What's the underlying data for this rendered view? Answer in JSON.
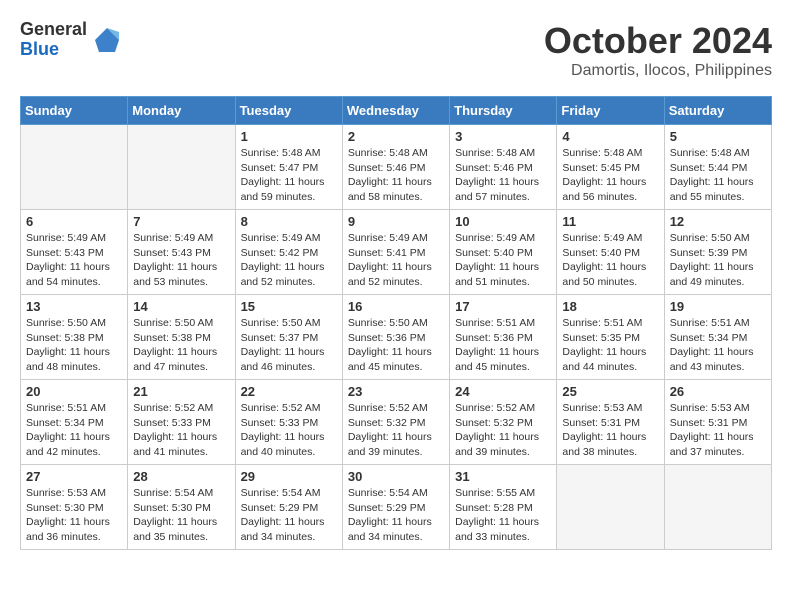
{
  "logo": {
    "general": "General",
    "blue": "Blue"
  },
  "title": "October 2024",
  "location": "Damortis, Ilocos, Philippines",
  "headers": [
    "Sunday",
    "Monday",
    "Tuesday",
    "Wednesday",
    "Thursday",
    "Friday",
    "Saturday"
  ],
  "weeks": [
    [
      {
        "day": "",
        "empty": true
      },
      {
        "day": "",
        "empty": true
      },
      {
        "day": "1",
        "sunrise": "Sunrise: 5:48 AM",
        "sunset": "Sunset: 5:47 PM",
        "daylight": "Daylight: 11 hours and 59 minutes."
      },
      {
        "day": "2",
        "sunrise": "Sunrise: 5:48 AM",
        "sunset": "Sunset: 5:46 PM",
        "daylight": "Daylight: 11 hours and 58 minutes."
      },
      {
        "day": "3",
        "sunrise": "Sunrise: 5:48 AM",
        "sunset": "Sunset: 5:46 PM",
        "daylight": "Daylight: 11 hours and 57 minutes."
      },
      {
        "day": "4",
        "sunrise": "Sunrise: 5:48 AM",
        "sunset": "Sunset: 5:45 PM",
        "daylight": "Daylight: 11 hours and 56 minutes."
      },
      {
        "day": "5",
        "sunrise": "Sunrise: 5:48 AM",
        "sunset": "Sunset: 5:44 PM",
        "daylight": "Daylight: 11 hours and 55 minutes."
      }
    ],
    [
      {
        "day": "6",
        "sunrise": "Sunrise: 5:49 AM",
        "sunset": "Sunset: 5:43 PM",
        "daylight": "Daylight: 11 hours and 54 minutes."
      },
      {
        "day": "7",
        "sunrise": "Sunrise: 5:49 AM",
        "sunset": "Sunset: 5:43 PM",
        "daylight": "Daylight: 11 hours and 53 minutes."
      },
      {
        "day": "8",
        "sunrise": "Sunrise: 5:49 AM",
        "sunset": "Sunset: 5:42 PM",
        "daylight": "Daylight: 11 hours and 52 minutes."
      },
      {
        "day": "9",
        "sunrise": "Sunrise: 5:49 AM",
        "sunset": "Sunset: 5:41 PM",
        "daylight": "Daylight: 11 hours and 52 minutes."
      },
      {
        "day": "10",
        "sunrise": "Sunrise: 5:49 AM",
        "sunset": "Sunset: 5:40 PM",
        "daylight": "Daylight: 11 hours and 51 minutes."
      },
      {
        "day": "11",
        "sunrise": "Sunrise: 5:49 AM",
        "sunset": "Sunset: 5:40 PM",
        "daylight": "Daylight: 11 hours and 50 minutes."
      },
      {
        "day": "12",
        "sunrise": "Sunrise: 5:50 AM",
        "sunset": "Sunset: 5:39 PM",
        "daylight": "Daylight: 11 hours and 49 minutes."
      }
    ],
    [
      {
        "day": "13",
        "sunrise": "Sunrise: 5:50 AM",
        "sunset": "Sunset: 5:38 PM",
        "daylight": "Daylight: 11 hours and 48 minutes."
      },
      {
        "day": "14",
        "sunrise": "Sunrise: 5:50 AM",
        "sunset": "Sunset: 5:38 PM",
        "daylight": "Daylight: 11 hours and 47 minutes."
      },
      {
        "day": "15",
        "sunrise": "Sunrise: 5:50 AM",
        "sunset": "Sunset: 5:37 PM",
        "daylight": "Daylight: 11 hours and 46 minutes."
      },
      {
        "day": "16",
        "sunrise": "Sunrise: 5:50 AM",
        "sunset": "Sunset: 5:36 PM",
        "daylight": "Daylight: 11 hours and 45 minutes."
      },
      {
        "day": "17",
        "sunrise": "Sunrise: 5:51 AM",
        "sunset": "Sunset: 5:36 PM",
        "daylight": "Daylight: 11 hours and 45 minutes."
      },
      {
        "day": "18",
        "sunrise": "Sunrise: 5:51 AM",
        "sunset": "Sunset: 5:35 PM",
        "daylight": "Daylight: 11 hours and 44 minutes."
      },
      {
        "day": "19",
        "sunrise": "Sunrise: 5:51 AM",
        "sunset": "Sunset: 5:34 PM",
        "daylight": "Daylight: 11 hours and 43 minutes."
      }
    ],
    [
      {
        "day": "20",
        "sunrise": "Sunrise: 5:51 AM",
        "sunset": "Sunset: 5:34 PM",
        "daylight": "Daylight: 11 hours and 42 minutes."
      },
      {
        "day": "21",
        "sunrise": "Sunrise: 5:52 AM",
        "sunset": "Sunset: 5:33 PM",
        "daylight": "Daylight: 11 hours and 41 minutes."
      },
      {
        "day": "22",
        "sunrise": "Sunrise: 5:52 AM",
        "sunset": "Sunset: 5:33 PM",
        "daylight": "Daylight: 11 hours and 40 minutes."
      },
      {
        "day": "23",
        "sunrise": "Sunrise: 5:52 AM",
        "sunset": "Sunset: 5:32 PM",
        "daylight": "Daylight: 11 hours and 39 minutes."
      },
      {
        "day": "24",
        "sunrise": "Sunrise: 5:52 AM",
        "sunset": "Sunset: 5:32 PM",
        "daylight": "Daylight: 11 hours and 39 minutes."
      },
      {
        "day": "25",
        "sunrise": "Sunrise: 5:53 AM",
        "sunset": "Sunset: 5:31 PM",
        "daylight": "Daylight: 11 hours and 38 minutes."
      },
      {
        "day": "26",
        "sunrise": "Sunrise: 5:53 AM",
        "sunset": "Sunset: 5:31 PM",
        "daylight": "Daylight: 11 hours and 37 minutes."
      }
    ],
    [
      {
        "day": "27",
        "sunrise": "Sunrise: 5:53 AM",
        "sunset": "Sunset: 5:30 PM",
        "daylight": "Daylight: 11 hours and 36 minutes."
      },
      {
        "day": "28",
        "sunrise": "Sunrise: 5:54 AM",
        "sunset": "Sunset: 5:30 PM",
        "daylight": "Daylight: 11 hours and 35 minutes."
      },
      {
        "day": "29",
        "sunrise": "Sunrise: 5:54 AM",
        "sunset": "Sunset: 5:29 PM",
        "daylight": "Daylight: 11 hours and 34 minutes."
      },
      {
        "day": "30",
        "sunrise": "Sunrise: 5:54 AM",
        "sunset": "Sunset: 5:29 PM",
        "daylight": "Daylight: 11 hours and 34 minutes."
      },
      {
        "day": "31",
        "sunrise": "Sunrise: 5:55 AM",
        "sunset": "Sunset: 5:28 PM",
        "daylight": "Daylight: 11 hours and 33 minutes."
      },
      {
        "day": "",
        "empty": true
      },
      {
        "day": "",
        "empty": true
      }
    ]
  ]
}
